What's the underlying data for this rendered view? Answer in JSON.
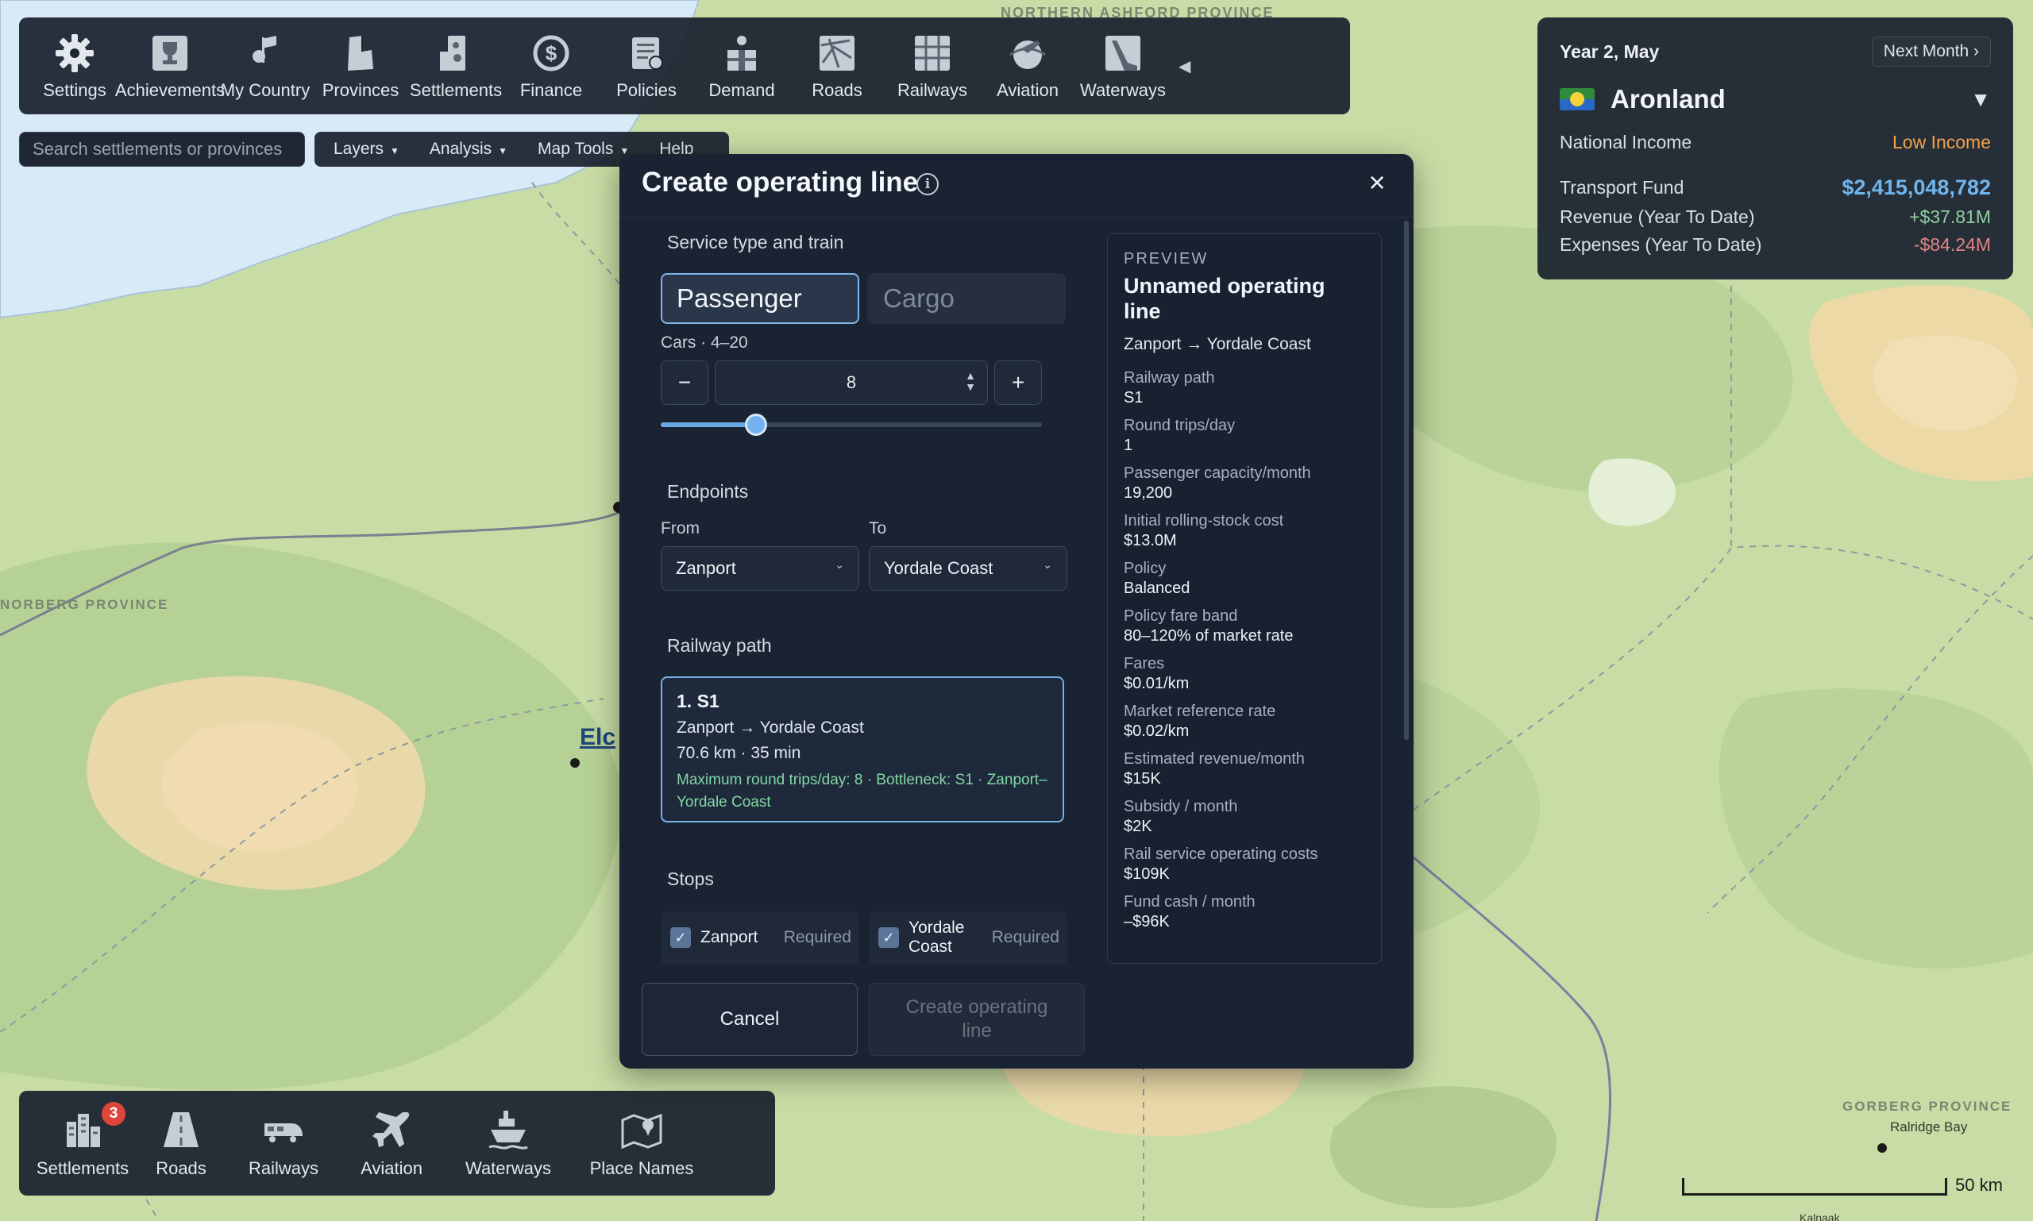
{
  "map": {
    "labels": {
      "north": "NORTHERN ASHFORD PROVINCE",
      "west": "NORBERG PROVINCE",
      "southeast": "GORBERG PROVINCE",
      "ralridge": "Ralridge Bay",
      "kalnaak": "Kalnaak",
      "elc": "Elc"
    },
    "scale_label": "50 km"
  },
  "top_toolbar": {
    "items": [
      {
        "label": "Settings",
        "icon": "gear-icon"
      },
      {
        "label": "Achievements",
        "icon": "trophy-icon"
      },
      {
        "label": "My Country",
        "icon": "country-icon"
      },
      {
        "label": "Provinces",
        "icon": "provinces-icon"
      },
      {
        "label": "Settlements",
        "icon": "settlements-icon"
      },
      {
        "label": "Finance",
        "icon": "finance-icon"
      },
      {
        "label": "Policies",
        "icon": "policies-icon"
      },
      {
        "label": "Demand",
        "icon": "demand-icon"
      },
      {
        "label": "Roads",
        "icon": "roads-icon"
      },
      {
        "label": "Railways",
        "icon": "railways-icon"
      },
      {
        "label": "Aviation",
        "icon": "aviation-icon"
      },
      {
        "label": "Waterways",
        "icon": "waterways-icon"
      }
    ],
    "collapse_glyph": "◀"
  },
  "search": {
    "placeholder": "Search settlements or provinces"
  },
  "menu_bar": {
    "layers": "Layers",
    "analysis": "Analysis",
    "map_tools": "Map Tools",
    "help": "Help",
    "caret": "▼"
  },
  "info_panel": {
    "date": "Year 2, May",
    "next_month": "Next Month ›",
    "country": "Aronland",
    "dropdown_glyph": "▼",
    "national_income_label": "National Income",
    "national_income_value": "Low Income",
    "transport_fund_label": "Transport Fund",
    "transport_fund_value": "$2,415,048,782",
    "revenue_label": "Revenue (Year To Date)",
    "revenue_value": "+$37.81M",
    "expenses_label": "Expenses (Year To Date)",
    "expenses_value": "-$84.24M",
    "colors": {
      "income": "#f0a24a",
      "fund": "#6fb6ef",
      "revenue": "#8fd0a0",
      "expenses": "#e08484"
    }
  },
  "bottom_toolbar": {
    "items": [
      {
        "label": "Settlements",
        "icon": "settlements-icon",
        "badge": "3"
      },
      {
        "label": "Roads",
        "icon": "road-icon"
      },
      {
        "label": "Railways",
        "icon": "train-icon"
      },
      {
        "label": "Aviation",
        "icon": "plane-icon"
      },
      {
        "label": "Waterways",
        "icon": "ship-icon"
      },
      {
        "label": "Place Names",
        "icon": "map-icon"
      }
    ]
  },
  "modal": {
    "title": "Create operating line",
    "info_glyph": "i",
    "close_glyph": "×",
    "service_label": "Service type and train",
    "passenger_label": "Passenger",
    "cargo_label": "Cargo",
    "cars_label": "Cars · 4–20",
    "minus": "−",
    "plus": "+",
    "cars_value": "8",
    "cars_min": 4,
    "cars_max": 20,
    "endpoints_label": "Endpoints",
    "from_label": "From",
    "to_label": "To",
    "from_value": "Zanport",
    "to_value": "Yordale Coast",
    "select_chevron": "⌄",
    "path_label": "Railway path",
    "path_card": {
      "title": "1. S1",
      "route": "Zanport → Yordale Coast",
      "stats": "70.6 km · 35 min",
      "note": "Maximum round trips/day: 8 · Bottleneck: S1 · Zanport–Yordale Coast"
    },
    "stops_label": "Stops",
    "stops": [
      {
        "name": "Zanport",
        "status": "Required"
      },
      {
        "name": "Yordale Coast",
        "status": "Required"
      }
    ],
    "check_glyph": "✓",
    "cancel_label": "Cancel",
    "create_label": "Create operating line",
    "preview": {
      "tag": "PREVIEW",
      "title": "Unnamed operating line",
      "route": "Zanport → Yordale Coast",
      "items": [
        {
          "k": "Railway path",
          "v": "S1"
        },
        {
          "k": "Round trips/day",
          "v": "1"
        },
        {
          "k": "Passenger capacity/month",
          "v": "19,200"
        },
        {
          "k": "Initial rolling-stock cost",
          "v": "$13.0M"
        },
        {
          "k": "Policy",
          "v": "Balanced"
        },
        {
          "k": "Policy fare band",
          "v": "80–120% of market rate"
        },
        {
          "k": "Fares",
          "v": "$0.01/km"
        },
        {
          "k": "Market reference rate",
          "v": "$0.02/km"
        },
        {
          "k": "Estimated revenue/month",
          "v": "$15K"
        },
        {
          "k": "Subsidy / month",
          "v": "$2K"
        },
        {
          "k": "Rail service operating costs",
          "v": "$109K"
        },
        {
          "k": "Fund cash / month",
          "v": "–$96K"
        }
      ]
    }
  }
}
